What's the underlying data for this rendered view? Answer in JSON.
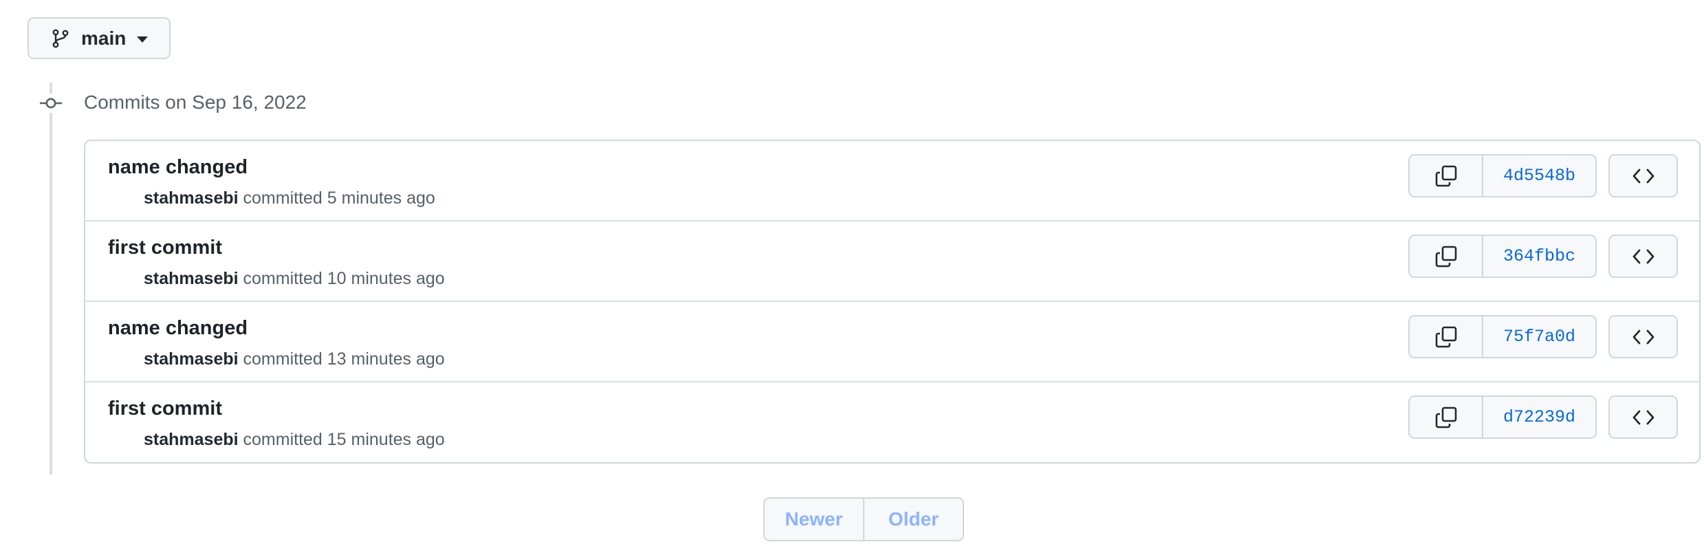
{
  "branch": {
    "name": "main",
    "icon": "git-branch-icon",
    "dropdown_icon": "triangle-down-icon"
  },
  "timeline": {
    "heading": "Commits on Sep 16, 2022",
    "icon": "git-commit-icon"
  },
  "commits": [
    {
      "title": "name changed",
      "author": "stahmasebi",
      "action": " committed ",
      "time": "5 minutes ago",
      "sha": "4d5548b"
    },
    {
      "title": "first commit",
      "author": "stahmasebi",
      "action": " committed ",
      "time": "10 minutes ago",
      "sha": "364fbbc"
    },
    {
      "title": "name changed",
      "author": "stahmasebi",
      "action": " committed ",
      "time": "13 minutes ago",
      "sha": "75f7a0d"
    },
    {
      "title": "first commit",
      "author": "stahmasebi",
      "action": " committed ",
      "time": "15 minutes ago",
      "sha": "d72239d"
    }
  ],
  "commit_icons": {
    "copy": "copy-icon",
    "browse": "code-icon"
  },
  "pagination": {
    "newer": "Newer",
    "older": "Older"
  },
  "colors": {
    "link": "#0969da",
    "border": "#d0d7de",
    "button_bg": "#f6f8fa",
    "disabled_text": "#8cb4ff",
    "muted_text": "#57606a"
  }
}
